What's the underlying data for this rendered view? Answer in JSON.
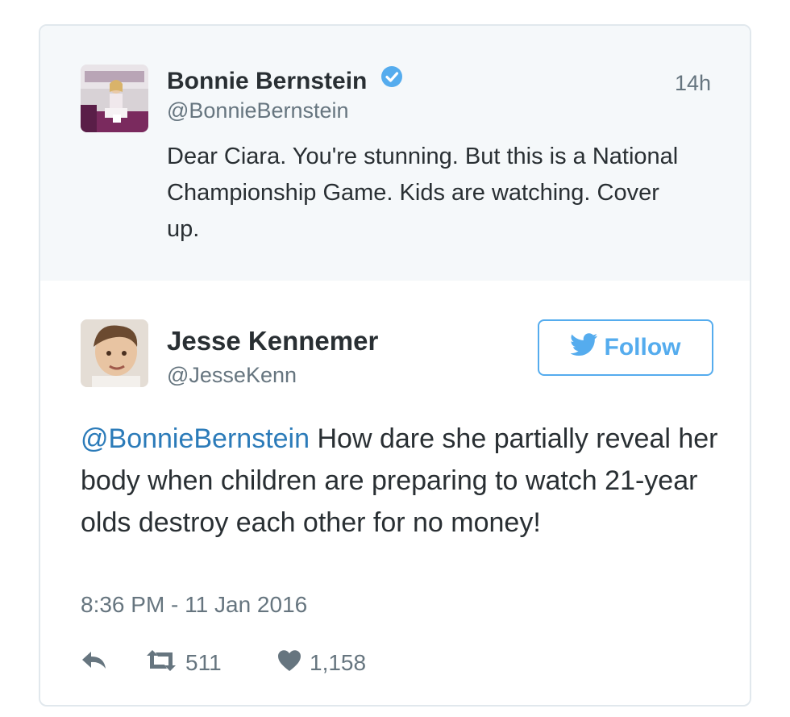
{
  "quoted": {
    "name": "Bonnie Bernstein",
    "handle": "@BonnieBernstein",
    "time_ago": "14h",
    "text": "Dear Ciara. You're stunning. But this is a National Championship Game. Kids are watching. Cover up.",
    "verified": true
  },
  "tweet": {
    "name": "Jesse Kennemer",
    "handle": "@JesseKenn",
    "follow_label": "Follow",
    "mention": "@BonnieBernstein",
    "text": " How dare she partially reveal her body when children are preparing to watch 21-year olds destroy each other for no money!",
    "timestamp": "8:36 PM - 11 Jan 2016",
    "retweets": "511",
    "likes": "1,158"
  },
  "colors": {
    "accent": "#55acee",
    "link": "#2b7bb9",
    "muted": "#66757f",
    "quoted_bg": "#f5f8fa"
  },
  "icons": [
    "verified-badge-icon",
    "twitter-bird-icon",
    "reply-icon",
    "retweet-icon",
    "heart-icon"
  ]
}
